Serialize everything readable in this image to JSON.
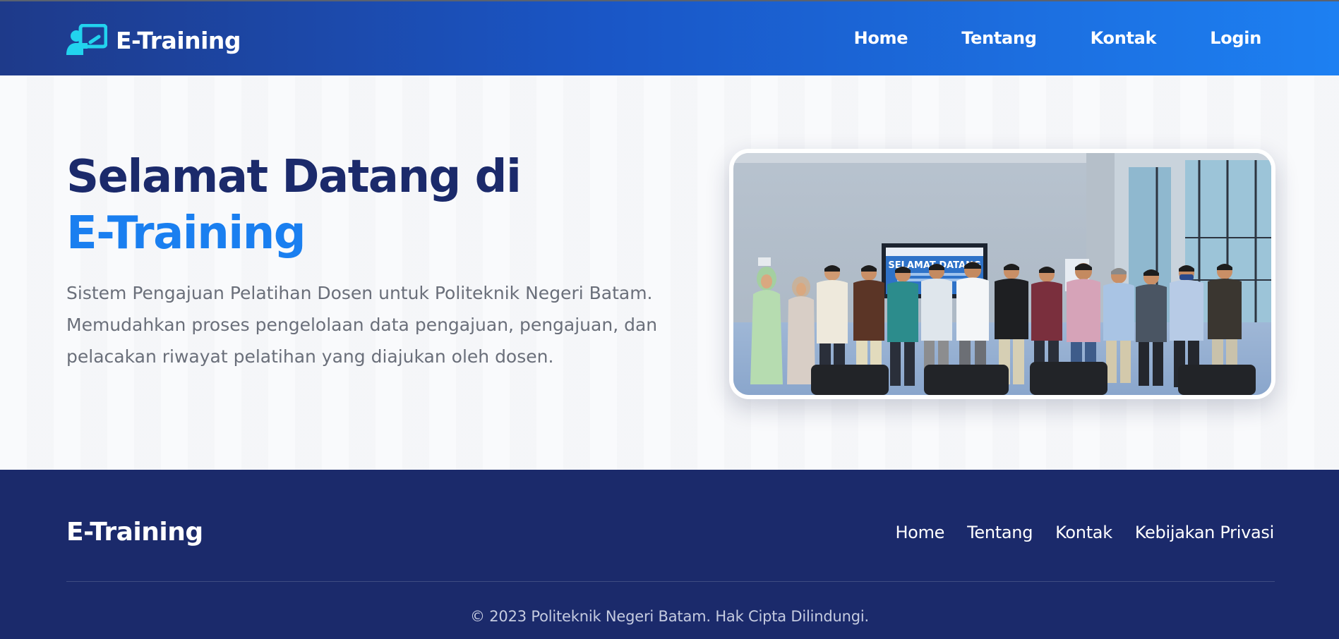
{
  "navbar": {
    "brand_icon": "teacher-board-icon",
    "brand_name": "E-Training",
    "links": [
      "Home",
      "Tentang",
      "Kontak",
      "Login"
    ]
  },
  "hero": {
    "title_line1": "Selamat Datang di",
    "title_line2": "E-Training",
    "description": "Sistem Pengajuan Pelatihan Dosen untuk Politeknik Negeri Batam. Memudahkan proses pengelolaan data pengajuan, pengajuan, dan pelacakan riwayat pelatihan yang diajukan oleh dosen.",
    "photo": {
      "screen_text": "SELAMAT DATANG",
      "description": "group-photo"
    }
  },
  "footer": {
    "brand_name": "E-Training",
    "links": [
      "Home",
      "Tentang",
      "Kontak",
      "Kebijakan Privasi"
    ],
    "copyright": "© 2023 Politeknik Negeri Batam. Hak Cipta Dilindungi."
  },
  "colors": {
    "primary_dark": "#1b2a6b",
    "primary_blue": "#1a7ff0",
    "nav_gradient_start": "#1e3a8a",
    "nav_gradient_end": "#1d80f2",
    "brand_icon": "#22d3ee"
  }
}
